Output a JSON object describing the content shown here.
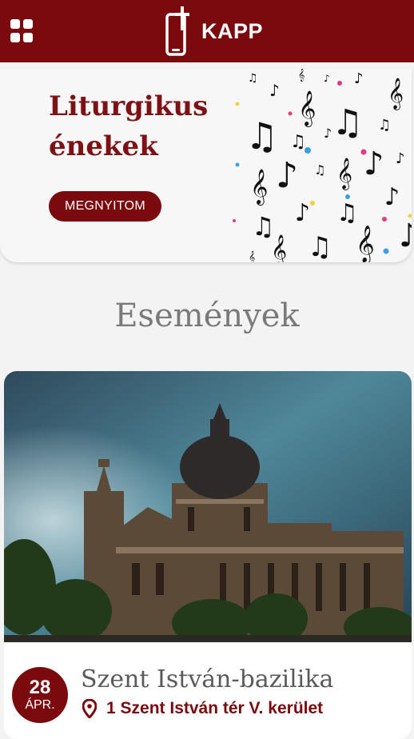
{
  "header": {
    "app_name": "KAPP",
    "menu_icon": "grid-icon",
    "logo_icon": "phone-cross-icon",
    "color": "#7a0a0e"
  },
  "banner": {
    "title": "Liturgikus énekek",
    "button_label": "MEGNYITOM",
    "decoration_icon": "music-notes-icon"
  },
  "events_section": {
    "title": "Események"
  },
  "event": {
    "day": "28",
    "month": "ÁPR.",
    "title": "Szent István-bazilika",
    "address": "1 Szent István tér V. kerület",
    "location_icon": "map-pin-icon"
  }
}
